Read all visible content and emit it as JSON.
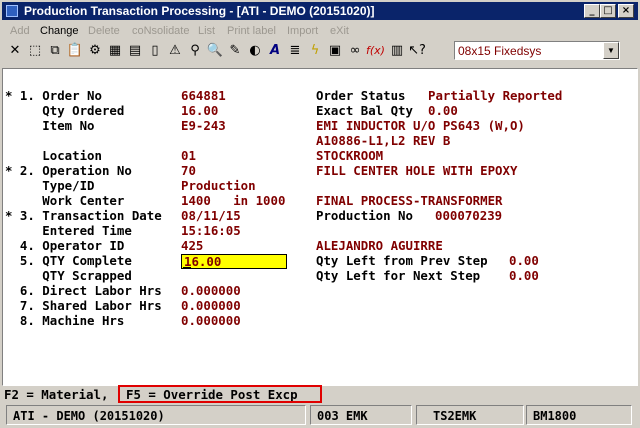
{
  "window": {
    "title": "Production Transaction Processing - [ATI - DEMO (20151020)]",
    "buttons": {
      "minimize": "_",
      "maximize": "□",
      "close": "×"
    }
  },
  "menu": [
    "Add",
    "Change",
    "Delete",
    "coNsolidate",
    "List",
    "Print label",
    "Import",
    "eXit"
  ],
  "toolbar": {
    "icons": [
      "x-icon",
      "select-icon",
      "copy-icon",
      "paste-icon",
      "gear-icon",
      "table-icon",
      "note-icon",
      "document-icon",
      "warning-icon",
      "binoculars-icon",
      "search-icon",
      "pen-icon",
      "globe-icon",
      "font-icon",
      "lines-icon",
      "lightning-icon",
      "calc-icon",
      "link-icon",
      "fx-icon",
      "notepad-icon",
      "help-pointer-icon"
    ],
    "font_combo": "08x15 Fixedsys"
  },
  "screen": {
    "rows": [
      {
        "label": "* 1. Order No",
        "value": "664881",
        "right_label": "Order Status",
        "right_value": "Partially Reported"
      },
      {
        "label": "     Qty Ordered",
        "value": "16.00",
        "right_label": "Exact Bal Qty",
        "right_value": "0.00"
      },
      {
        "label": "     Item No",
        "value": "E9-243",
        "right_label": "",
        "right_value": "EMI INDUCTOR U/O PS643 (W,O)"
      },
      {
        "label": "",
        "value": "",
        "right_label": "",
        "right_value": "A10886-L1,L2 REV B"
      },
      {
        "label": "     Location",
        "value": "01",
        "right_label": "",
        "right_value": "STOCKROOM"
      },
      {
        "label": "* 2. Operation No",
        "value": "70",
        "right_label": "",
        "right_value": "FILL CENTER HOLE WITH EPOXY"
      },
      {
        "label": "     Type/ID",
        "value": "Production",
        "right_label": "",
        "right_value": ""
      },
      {
        "label": "     Work Center",
        "value": "1400   in 1000",
        "right_label": "",
        "right_value": "FINAL PROCESS-TRANSFORMER"
      },
      {
        "label": "* 3. Transaction Date",
        "value": "08/11/15",
        "right_label": "Production No",
        "right_value": "000070239"
      },
      {
        "label": "     Entered Time",
        "value": "15:16:05",
        "right_label": "",
        "right_value": ""
      },
      {
        "label": "  4. Operator ID",
        "value": "425",
        "right_label": "",
        "right_value": "ALEJANDRO AGUIRRE"
      },
      {
        "label": "  5. QTY Complete",
        "value": "",
        "right_label": "Qty Left from Prev Step",
        "right_value": "0.00"
      },
      {
        "label": "     QTY Scrapped",
        "value": "",
        "right_label": "Qty Left for Next Step",
        "right_value": "0.00"
      },
      {
        "label": "  6. Direct Labor Hrs",
        "value": "0.000000",
        "right_label": "",
        "right_value": ""
      },
      {
        "label": "  7. Shared Labor Hrs",
        "value": "0.000000",
        "right_label": "",
        "right_value": ""
      },
      {
        "label": "  8. Machine Hrs",
        "value": "0.000000",
        "right_label": "",
        "right_value": ""
      }
    ],
    "qty_complete_input": "16.00"
  },
  "fkeys": {
    "f2": "F2 = Material,",
    "f5": "F5 = Override Post Excp"
  },
  "status": {
    "company": "ATI - DEMO (20151020)",
    "terminal": "003 EMK",
    "user": "TS2EMK",
    "screen_id": "BM1800"
  },
  "colors": {
    "title_bar": "#0a246a",
    "value_text": "#800000",
    "highlight_field": "#ffff00",
    "f5_box": "#e00000"
  }
}
